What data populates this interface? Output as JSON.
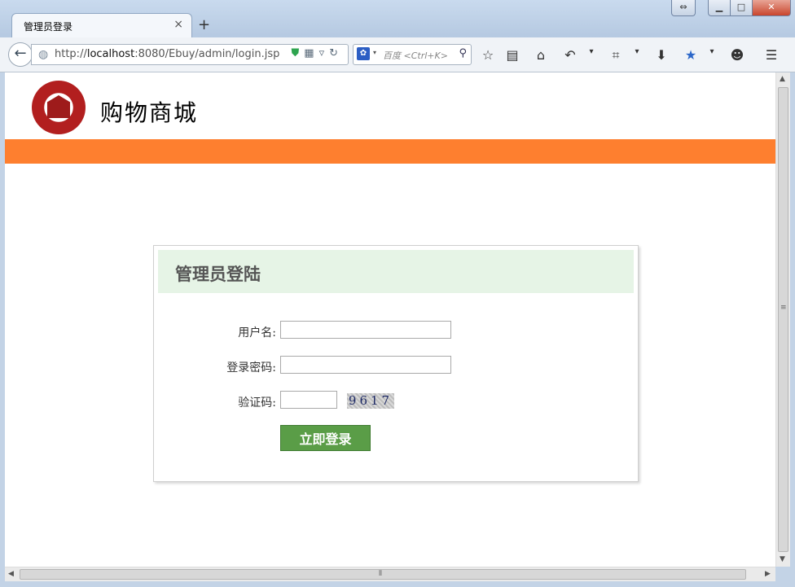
{
  "browser": {
    "tab_title": "管理员登录",
    "tab_close": "×",
    "new_tab": "+",
    "url_prefix": "http://",
    "url_host": "localhost",
    "url_rest": ":8080/Ebuy/admin/login.jsp",
    "search_placeholder": "百度 <Ctrl+K>",
    "icons": [
      "back-arrow-icon",
      "globe-icon",
      "shield-icon",
      "qr-icon",
      "dropdown-icon",
      "reload-icon",
      "baidu-paw-icon",
      "search-icon",
      "star-icon",
      "reader-icon",
      "home-icon",
      "undo-icon",
      "crop-icon",
      "download-icon",
      "bookmark-star-icon",
      "chat-icon",
      "menu-icon"
    ]
  },
  "site": {
    "title": "购物商城",
    "brand_color": "#fe7f2f"
  },
  "login": {
    "heading": "管理员登陆",
    "username_label": "用户名:",
    "password_label": "登录密码:",
    "captcha_label": "验证码:",
    "username_value": "",
    "password_value": "",
    "captcha_value": "",
    "captcha_image_text": "9617",
    "submit_label": "立即登录",
    "button_color": "#5a9d47",
    "header_color": "#e6f4e6"
  }
}
